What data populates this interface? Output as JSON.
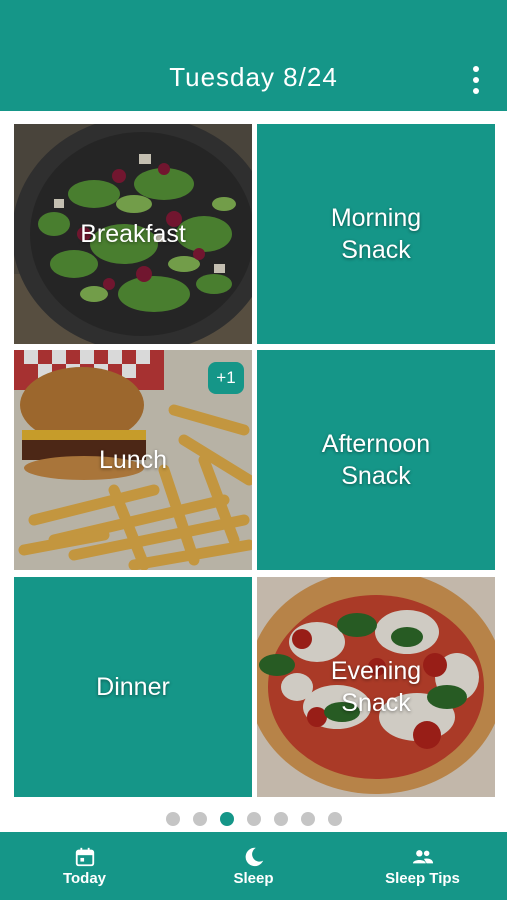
{
  "header": {
    "title": "Tuesday 8/24",
    "menu_icon": "more-vert-icon"
  },
  "meals": [
    {
      "label": "Breakfast",
      "has_photo": true,
      "photo": "salad"
    },
    {
      "label": "Morning\nSnack",
      "has_photo": false
    },
    {
      "label": "Lunch",
      "has_photo": true,
      "photo": "burger-fries",
      "badge": "+1"
    },
    {
      "label": "Afternoon\nSnack",
      "has_photo": false
    },
    {
      "label": "Dinner",
      "has_photo": false
    },
    {
      "label": "Evening\nSnack",
      "has_photo": true,
      "photo": "pizza"
    }
  ],
  "pager": {
    "count": 7,
    "active_index": 2
  },
  "bottom_nav": [
    {
      "label": "Today",
      "icon": "calendar-icon"
    },
    {
      "label": "Sleep",
      "icon": "moon-icon"
    },
    {
      "label": "Sleep Tips",
      "icon": "people-icon"
    }
  ],
  "colors": {
    "primary": "#159688",
    "dot_inactive": "#c5c5c5"
  }
}
